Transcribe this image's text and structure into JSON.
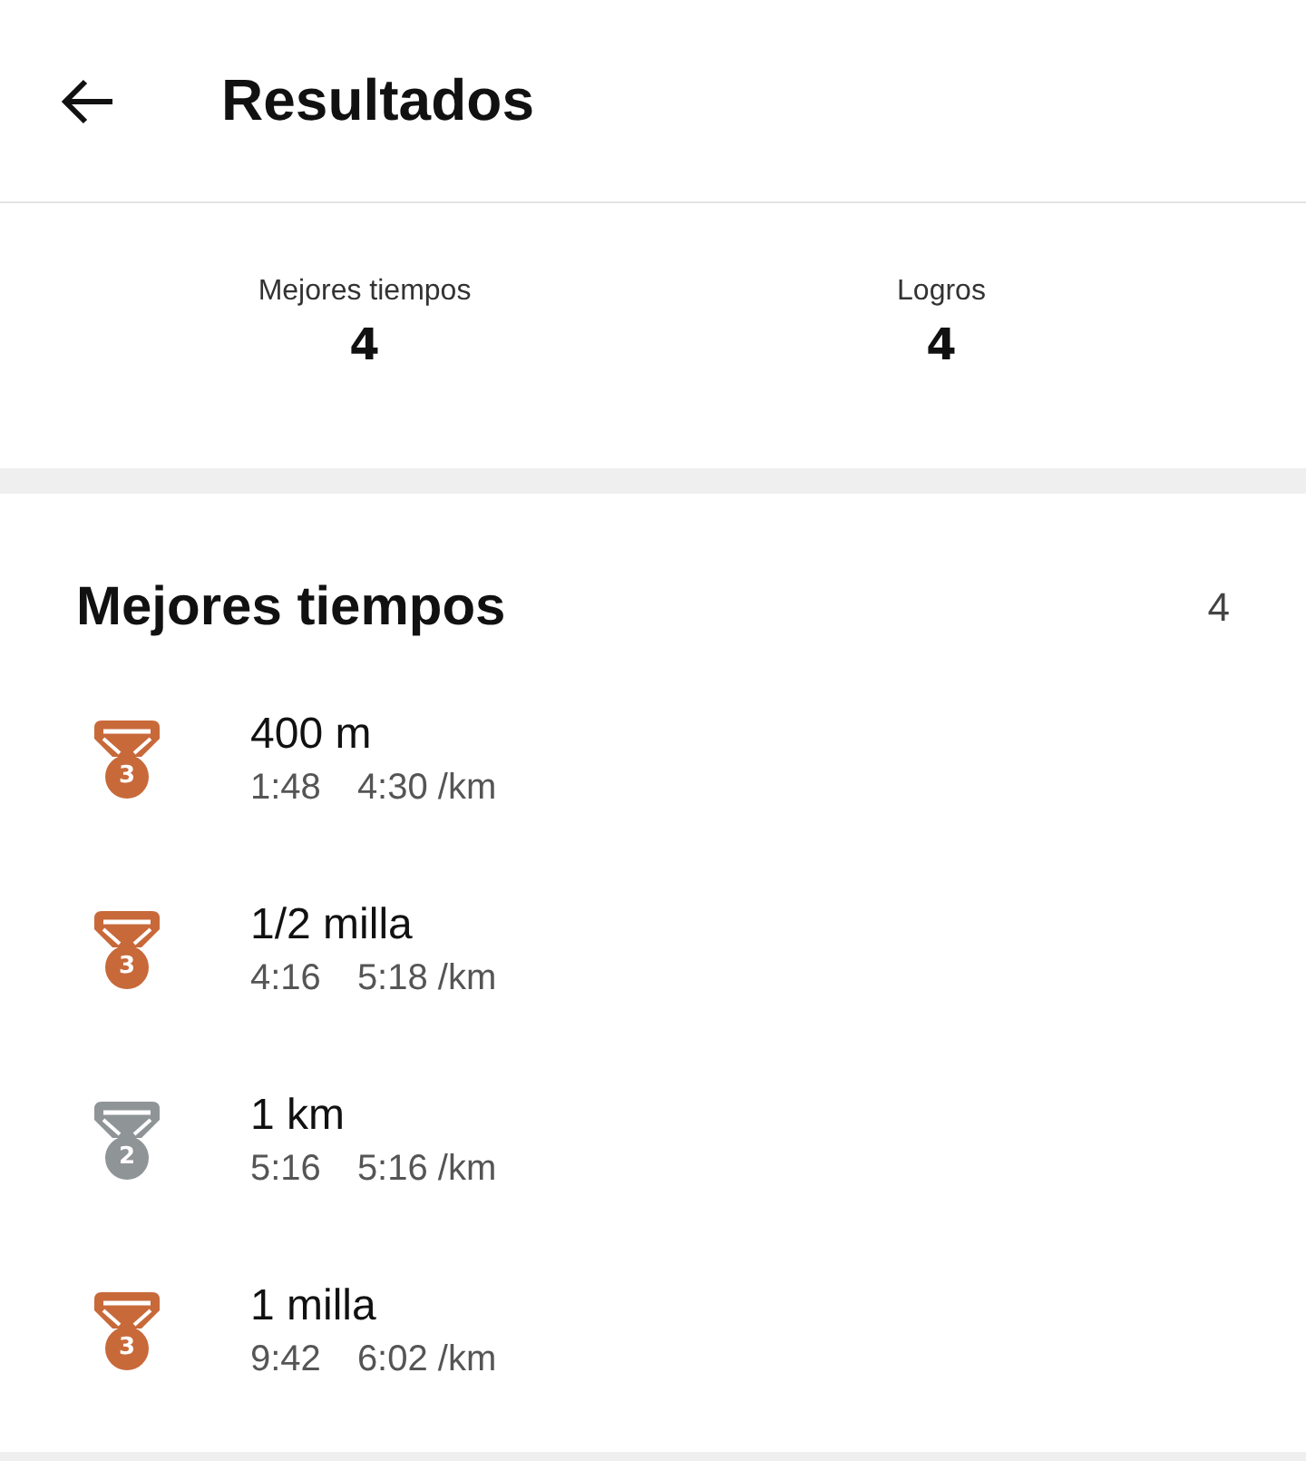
{
  "header": {
    "title": "Resultados"
  },
  "stats": [
    {
      "label": "Mejores tiempos",
      "value": "4"
    },
    {
      "label": "Logros",
      "value": "4"
    }
  ],
  "section": {
    "title": "Mejores tiempos",
    "count": "4"
  },
  "records": [
    {
      "distance": "400 m",
      "time": "1:48",
      "pace": "4:30 /km",
      "rank": "3",
      "color": "#c8693a"
    },
    {
      "distance": "1/2 milla",
      "time": "4:16",
      "pace": "5:18 /km",
      "rank": "3",
      "color": "#c8693a"
    },
    {
      "distance": "1 km",
      "time": "5:16",
      "pace": "5:16 /km",
      "rank": "2",
      "color": "#8f9496"
    },
    {
      "distance": "1 milla",
      "time": "9:42",
      "pace": "6:02 /km",
      "rank": "3",
      "color": "#c8693a"
    }
  ]
}
